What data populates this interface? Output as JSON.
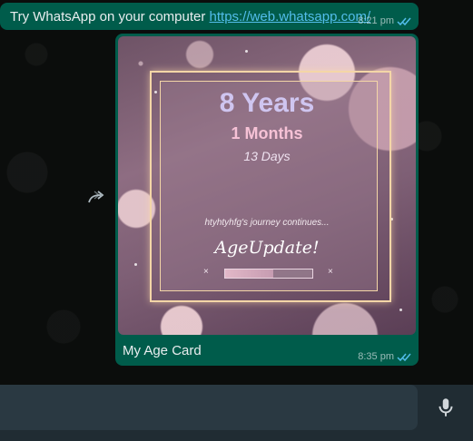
{
  "messages": [
    {
      "text_prefix": "Try WhatsApp on your computer ",
      "link": "https://web.whatsapp.com/",
      "time": "8:21 pm",
      "status": "read"
    },
    {
      "caption": "My Age Card",
      "time": "8:35 pm",
      "status": "read",
      "card": {
        "years": "8 Years",
        "months": "1 Months",
        "days": "13 Days",
        "journey": "htyhtyhfg's journey continues...",
        "brand": "AgeUpdate!",
        "progress": 0.55
      }
    }
  ],
  "icons": {
    "forward": "forward-icon",
    "mic": "microphone-icon",
    "ticks": "double-check-icon"
  },
  "colors": {
    "bubble": "#005c4b",
    "link": "#53bdeb",
    "ticks": "#53bdeb",
    "input_bar": "#202c33"
  }
}
